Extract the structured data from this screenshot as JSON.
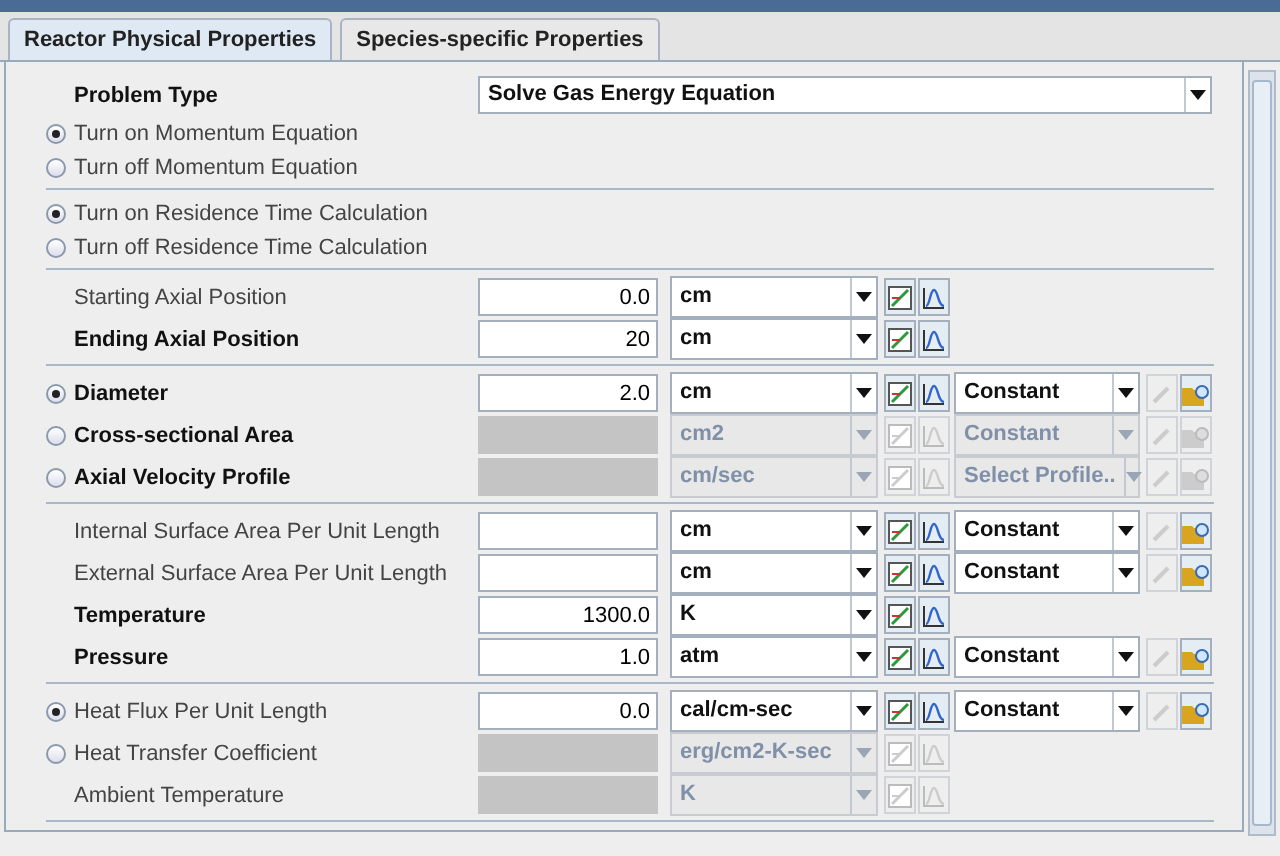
{
  "tabs": [
    {
      "label": "Reactor Physical Properties",
      "selected": true
    },
    {
      "label": "Species-specific Properties",
      "selected": false
    }
  ],
  "sections": [
    {
      "rows": [
        {
          "kind": "select",
          "label": "Problem Type",
          "value": "Solve Gas Energy Equation"
        },
        {
          "kind": "option",
          "label": "Turn on Momentum Equation",
          "selected": true
        },
        {
          "kind": "option",
          "label": "Turn off Momentum Equation",
          "selected": false
        }
      ]
    },
    {
      "rows": [
        {
          "kind": "option",
          "label": "Turn on Residence Time Calculation",
          "selected": true
        },
        {
          "kind": "option",
          "label": "Turn off Residence Time Calculation",
          "selected": false
        }
      ]
    },
    {
      "rows": [
        {
          "kind": "param",
          "label": "Starting Axial Position",
          "bold": false,
          "value": "0.0",
          "unit": "cm",
          "disabled": false
        },
        {
          "kind": "param",
          "label": "Ending Axial Position",
          "bold": true,
          "value": "20",
          "unit": "cm",
          "disabled": false
        }
      ]
    },
    {
      "rows": [
        {
          "kind": "param",
          "label": "Diameter",
          "bold": true,
          "selected": true,
          "value": "2.0",
          "unit": "cm",
          "disabled": false,
          "profile": "Constant"
        },
        {
          "kind": "param",
          "label": "Cross-sectional Area",
          "bold": true,
          "selected": false,
          "unit": "cm2",
          "disabled": true,
          "profile": "Constant"
        },
        {
          "kind": "param",
          "label": "Axial Velocity Profile",
          "bold": true,
          "selected": false,
          "unit": "cm/sec",
          "disabled": true,
          "profile": "Select Profile.."
        }
      ]
    },
    {
      "rows": [
        {
          "kind": "param",
          "label": "Internal Surface Area Per Unit Length",
          "bold": false,
          "unit": "cm",
          "disabled": false,
          "profile": "Constant"
        },
        {
          "kind": "param",
          "label": "External Surface Area Per Unit Length",
          "bold": false,
          "unit": "cm",
          "disabled": false,
          "profile": "Constant"
        },
        {
          "kind": "param",
          "label": "Temperature",
          "bold": true,
          "value": "1300.0",
          "unit": "K",
          "disabled": false
        },
        {
          "kind": "param",
          "label": "Pressure",
          "bold": true,
          "value": "1.0",
          "unit": "atm",
          "disabled": false,
          "profile": "Constant"
        }
      ]
    },
    {
      "rows": [
        {
          "kind": "param",
          "label": "Heat Flux Per Unit Length",
          "bold": false,
          "selected": true,
          "value": "0.0",
          "unit": "cal/cm-sec",
          "disabled": false,
          "profile": "Constant"
        },
        {
          "kind": "param",
          "label": "Heat Transfer Coefficient",
          "bold": false,
          "selected": false,
          "unit": "erg/cm2-K-sec",
          "disabled": true
        },
        {
          "kind": "param",
          "label": "Ambient Temperature",
          "bold": false,
          "unit": "K",
          "disabled": true
        }
      ]
    }
  ]
}
